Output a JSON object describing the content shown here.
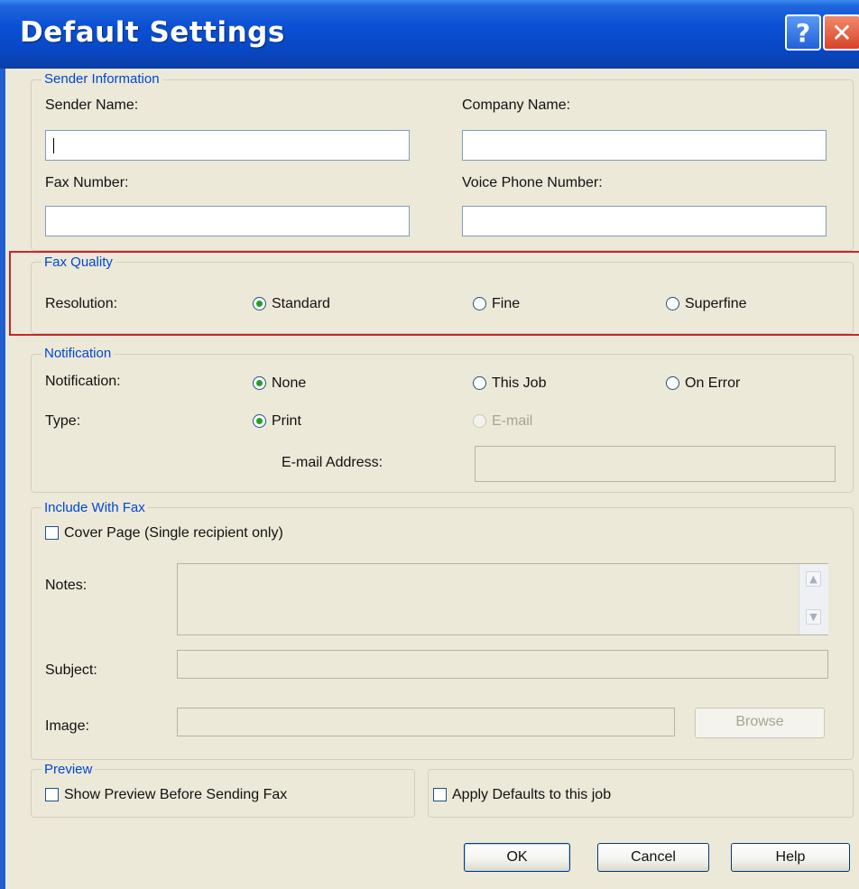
{
  "window": {
    "title": "Default Settings",
    "help_glyph": "?",
    "close_glyph": "✕"
  },
  "sender": {
    "legend": "Sender Information",
    "sender_name_label": "Sender Name:",
    "company_name_label": "Company Name:",
    "fax_number_label": "Fax Number:",
    "voice_phone_label": "Voice Phone Number:"
  },
  "quality": {
    "legend": "Fax Quality",
    "resolution_label": "Resolution:",
    "options": [
      "Standard",
      "Fine",
      "Superfine"
    ],
    "selected": "Standard"
  },
  "notification": {
    "legend": "Notification",
    "notification_label": "Notification:",
    "options": [
      "None",
      "This Job",
      "On Error"
    ],
    "selected": "None",
    "type_label": "Type:",
    "type_options": [
      "Print",
      "E-mail"
    ],
    "type_selected": "Print",
    "email_address_label": "E-mail Address:"
  },
  "include": {
    "legend": "Include With Fax",
    "cover_page_label": "Cover Page (Single recipient only)",
    "cover_page_checked": false,
    "notes_label": "Notes:",
    "subject_label": "Subject:",
    "image_label": "Image:",
    "browse_label": "Browse"
  },
  "preview": {
    "legend": "Preview",
    "show_preview_label": "Show Preview Before Sending Fax",
    "show_preview_checked": false,
    "apply_defaults_label": "Apply Defaults to this job",
    "apply_defaults_checked": false
  },
  "buttons": {
    "ok": "OK",
    "cancel": "Cancel",
    "help": "Help"
  },
  "colors": {
    "title_bar": "#0a4fd4",
    "legend_text": "#0046d5",
    "dialog_bg": "#ece9d8",
    "highlight": "#c8262b"
  }
}
